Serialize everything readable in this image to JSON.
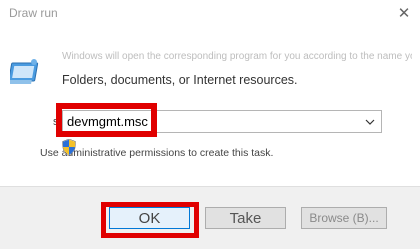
{
  "window": {
    "title": "Draw run",
    "close_glyph": "✕"
  },
  "dialog": {
    "description_faded": "Windows will open the corresponding program for you according to the name you en-",
    "description_line2": "Folders, documents, or Internet resources.",
    "open_label": "s:",
    "input_value": "devmgmt.msc",
    "admin_note": "Use administrative permissions to create this task.",
    "icon": "run-dialog-icon"
  },
  "buttons": {
    "ok_label": "OK",
    "cancel_label": "Take",
    "browse_label": "Browse (B)..."
  },
  "colors": {
    "highlight": "#e00000",
    "ok_border": "#0078d7"
  }
}
